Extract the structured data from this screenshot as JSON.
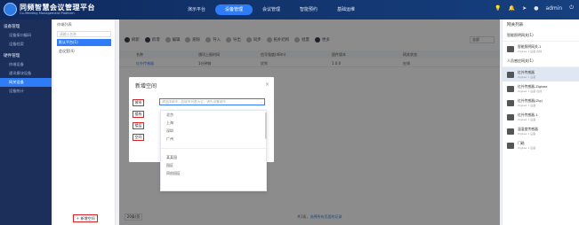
{
  "header": {
    "brand": "同频智慧会议管理平台",
    "brand_sub": "Co-Meeting Management Platform",
    "nav": [
      "演示平台",
      "设备管理",
      "会议管理",
      "智能预约",
      "基础运维"
    ],
    "user": "admin"
  },
  "sidebar": {
    "groups": [
      {
        "label": "设备管理",
        "items": [
          "设备接口编码",
          "设备档案"
        ]
      },
      {
        "label": "硬件管理",
        "items": [
          "终端设备",
          "通讯模块设备",
          "网关设备",
          "设备统计"
        ]
      }
    ]
  },
  "tree": {
    "title": "终端列表",
    "search_placeholder": "请输入名称",
    "nodes": [
      "默认平台(1)",
      "会议室(4)"
    ]
  },
  "add_room_button": "新增空间",
  "toolbar": {
    "items": [
      "刷新",
      "新增",
      "编辑",
      "删除",
      "导入",
      "导出",
      "同步",
      "拓扑结构",
      "批量",
      "更多"
    ],
    "filter_value": "全部"
  },
  "table": {
    "columns": [
      "",
      "名称",
      "通讯上报时间",
      "信号强度(dBm)",
      "固件版本",
      "网关状态"
    ],
    "rows": [
      [
        "",
        "红外传感器",
        "1分钟前",
        "优秀",
        "1.0.0",
        "在线"
      ]
    ]
  },
  "pager": {
    "size": "20条/页",
    "info": "共1条，",
    "link": "选择所有页面的记录"
  },
  "right_panel": {
    "title": "网关列表",
    "groups": [
      "智能照明网关(1)",
      "人员感应网关(1)"
    ],
    "devices": [
      {
        "name": "智能照明网关-1",
        "sub": "Zigbee 1 设备 在线"
      },
      {
        "name": "红外传感器",
        "sub": "Zigbee 1 设备"
      },
      {
        "name": "红外传感器-Zigbee",
        "sub": "Zigbee 1 设备 在线"
      },
      {
        "name": "红外传感器(Zig)",
        "sub": "Zigbee 1 设备"
      },
      {
        "name": "红外传感器-1",
        "sub": "Zigbee 1 设备"
      },
      {
        "name": "温湿度传感器",
        "sub": "Zigbee 1 设备"
      },
      {
        "name": "门磁",
        "sub": "Zigbee 1 设备"
      }
    ]
  },
  "modal": {
    "title": "新增空间",
    "fields": [
      "城市",
      "楼栋",
      "楼层",
      "空间"
    ],
    "select_placeholder": "请选择城市，若城市列表为空，请先设置城市",
    "options_top": [
      "北京",
      "上海",
      "深圳",
      "广州"
    ],
    "options_bottom": [
      "某某园",
      "园区",
      "同创园区"
    ]
  }
}
